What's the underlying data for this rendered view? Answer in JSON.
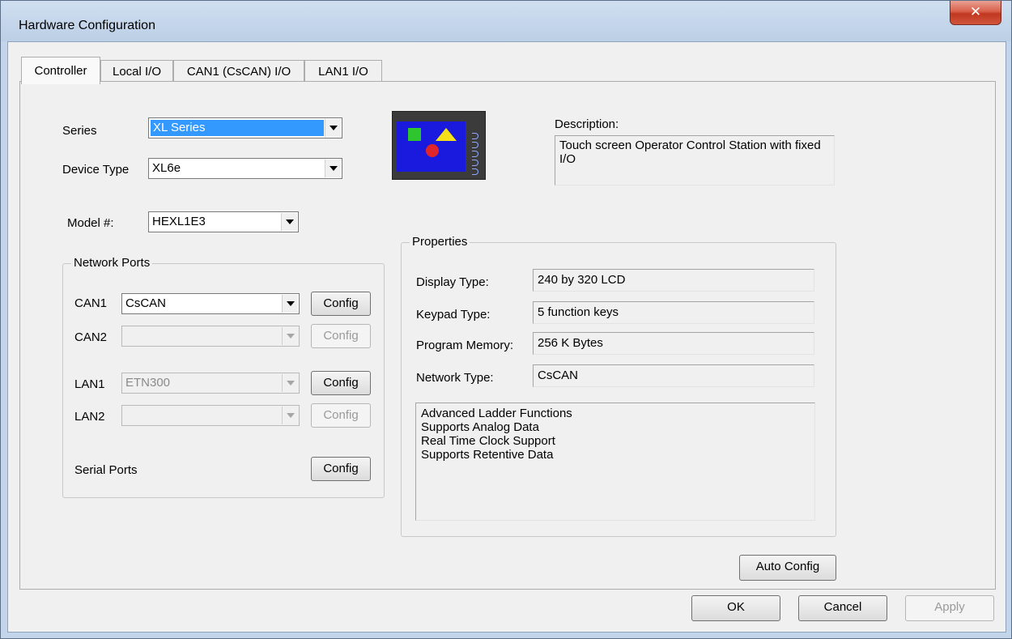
{
  "window": {
    "title": "Hardware Configuration",
    "close_glyph": "✕"
  },
  "tabs": [
    "Controller",
    "Local I/O",
    "CAN1 (CsCAN) I/O",
    "LAN1 I/O"
  ],
  "controller": {
    "series_label": "Series",
    "series_value": "XL Series",
    "device_type_label": "Device Type",
    "device_type_value": "XL6e",
    "model_label": "Model #:",
    "model_value": "HEXL1E3",
    "description_label": "Description:",
    "description_value": "Touch screen Operator Control Station with fixed I/O",
    "network_ports": {
      "title": "Network Ports",
      "can1_label": "CAN1",
      "can1_value": "CsCAN",
      "can2_label": "CAN2",
      "can2_value": "",
      "lan1_label": "LAN1",
      "lan1_value": "ETN300",
      "lan2_label": "LAN2",
      "lan2_value": "",
      "serial_label": "Serial Ports",
      "config_label": "Config"
    },
    "properties": {
      "title": "Properties",
      "display_type_label": "Display Type:",
      "display_type_value": "240 by 320 LCD",
      "keypad_type_label": "Keypad Type:",
      "keypad_type_value": "5 function keys",
      "program_memory_label": "Program Memory:",
      "program_memory_value": "256 K Bytes",
      "network_type_label": "Network Type:",
      "network_type_value": "CsCAN",
      "features": [
        "Advanced Ladder Functions",
        "Supports Analog Data",
        "Real Time Clock Support",
        "Supports Retentive Data"
      ]
    },
    "auto_config_label": "Auto Config"
  },
  "footer": {
    "ok_label": "OK",
    "cancel_label": "Cancel",
    "apply_label": "Apply"
  },
  "icons": {
    "device_image": "xl6e-device-icon",
    "close": "close-icon",
    "dropdown": "chevron-down-icon"
  }
}
